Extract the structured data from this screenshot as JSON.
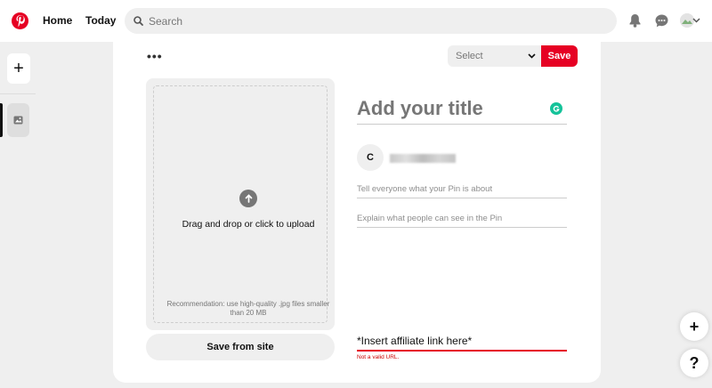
{
  "header": {
    "nav_home": "Home",
    "nav_today": "Today",
    "search_placeholder": "Search"
  },
  "toolbar": {
    "more_label": "•••",
    "board_select": "Select",
    "save_label": "Save"
  },
  "upload": {
    "drag_text": "Drag and drop or click to upload",
    "recommendation": "Recommendation: use high-quality .jpg files smaller than 20 MB",
    "save_from_site": "Save from site"
  },
  "form": {
    "title_placeholder": "Add your title",
    "user_initial": "C",
    "description_placeholder": "Tell everyone what your Pin is about",
    "alt_text_placeholder": "Explain what people can see in the Pin",
    "link_value": "*Insert affiliate link here*",
    "link_error": "Not a valid URL."
  },
  "fab": {
    "add_label": "+",
    "help_label": "?"
  },
  "sidebar": {
    "create_label": "+"
  },
  "colors": {
    "brand": "#e60023",
    "grammarly": "#15c39a"
  }
}
